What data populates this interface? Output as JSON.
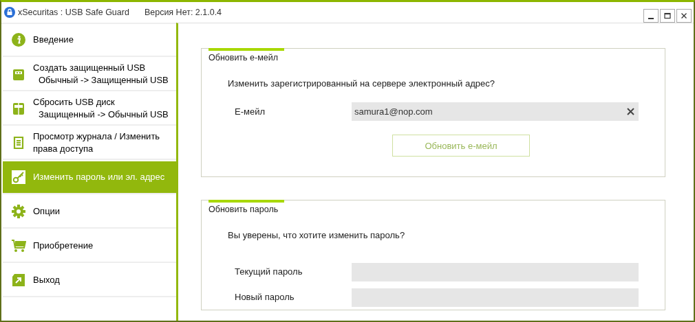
{
  "window": {
    "title": "xSecuritas : USB Safe Guard",
    "version": "Версия Нет: 2.1.0.4"
  },
  "sidebar": {
    "items": [
      {
        "kind": "info",
        "label": "Введение",
        "selected": false
      },
      {
        "kind": "usb",
        "label": "Создать защищенный USB",
        "sublabel": "Обычный -> Защищенный USB",
        "selected": false
      },
      {
        "kind": "usb2",
        "label": "Сбросить USB диск",
        "sublabel": "Защищенный -> Обычный USB",
        "selected": false
      },
      {
        "kind": "log",
        "label": "Просмотр журнала / Изменить права доступа",
        "selected": false
      },
      {
        "kind": "key",
        "label": "Изменить пароль или эл. адрес",
        "selected": true
      },
      {
        "kind": "gear",
        "label": "Опции",
        "selected": false
      },
      {
        "kind": "cart",
        "label": "Приобретение",
        "selected": false
      },
      {
        "kind": "exit",
        "label": "Выход",
        "selected": false
      }
    ]
  },
  "email_panel": {
    "title": "Обновить е-мейл",
    "question": "Изменить зарегистрированный на сервере электронный адрес?",
    "field_label": "Е-мейл",
    "value": "samura1@nop.com",
    "button": "Обновить е-мейл",
    "button_disabled": true
  },
  "password_panel": {
    "title": "Обновить пароль",
    "question": "Вы уверены, что хотите изменить пароль?",
    "fields": [
      {
        "label": "Текущий пароль"
      },
      {
        "label": "Новый пароль"
      }
    ]
  }
}
